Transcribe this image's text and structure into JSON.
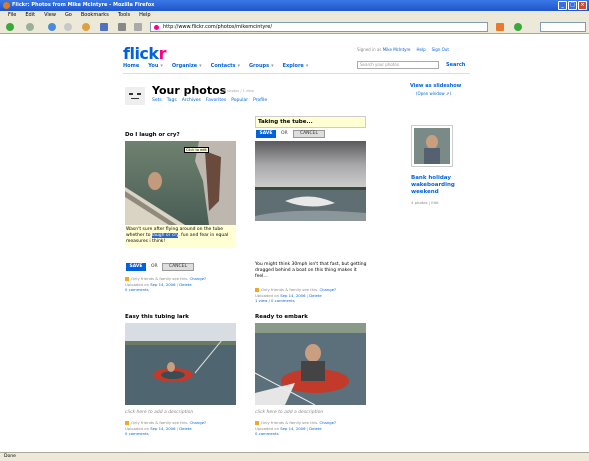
{
  "window": {
    "title": "Flickr: Photos from Mike McIntyre - Mozilla Firefox"
  },
  "menu": [
    "File",
    "Edit",
    "View",
    "Go",
    "Bookmarks",
    "Tools",
    "Help"
  ],
  "address": {
    "url": "http://www.flickr.com/photos/mikemcintyre/"
  },
  "header": {
    "signed_in_prefix": "Signed in as",
    "user": "Mike McIntyre",
    "help": "Help",
    "signout": "Sign Out",
    "logo_a": "flick",
    "logo_b": "r",
    "nav": [
      "Home",
      "You",
      "Organize",
      "Contacts",
      "Groups",
      "Explore"
    ],
    "search_placeholder": "Search your photos",
    "search_label": "Search"
  },
  "profile": {
    "title": "Your photos",
    "subtitle": "4 photos / 1 view",
    "tabs": [
      "Sets",
      "Tags",
      "Archives",
      "Favorites",
      "Popular",
      "Profile"
    ],
    "slideshow": "View as slideshow",
    "slideshow_sub": "(Open window ⇗)"
  },
  "photos": [
    {
      "title": "Do I laugh or cry?",
      "desc_a": "Wasn't sure after flying around on the tube whether to",
      "desc_hl": "laugh or cry",
      "desc_b": ". fun and fear in equal measures i think!",
      "privacy": "Only friends & family see this.",
      "change": "Change?",
      "uploaded": "Uploaded on",
      "date": "Sep 14, 2006",
      "delete": "Delete",
      "comments": "0 comments"
    },
    {
      "title": "Taking the tube...",
      "desc": "You might think 30mph isn't that fast, but getting dragged behind a boat on this thing makes it feel...",
      "privacy": "Only friends & family see this.",
      "change": "Change?",
      "uploaded": "Uploaded on",
      "date": "Sep 14, 2006",
      "delete": "Delete",
      "comments": "1 view / 0 comments"
    },
    {
      "title": "Easy this tubing lark",
      "desc": "click here to add a description",
      "privacy": "Only friends & family see this.",
      "change": "Change?",
      "uploaded": "Uploaded on",
      "date": "Sep 14, 2006",
      "delete": "Delete",
      "comments": "0 comments"
    },
    {
      "title": "Ready to embark",
      "desc": "click here to add a description",
      "privacy": "Only friends & family see this.",
      "change": "Change?",
      "uploaded": "Uploaded on",
      "date": "Sep 14, 2006",
      "delete": "Delete",
      "comments": "0 comments"
    }
  ],
  "buttons": {
    "save": "SAVE",
    "or": "OR",
    "cancel": "CANCEL"
  },
  "tooltip": "Click to edit",
  "set": {
    "title": "Bank holiday wakeboarding weekend",
    "count": "4 photos | Edit"
  },
  "status": "Done",
  "colors": {
    "flickr_blue": "#0063dc",
    "flickr_pink": "#ff0084",
    "edit_yellow": "#ffffd3"
  }
}
